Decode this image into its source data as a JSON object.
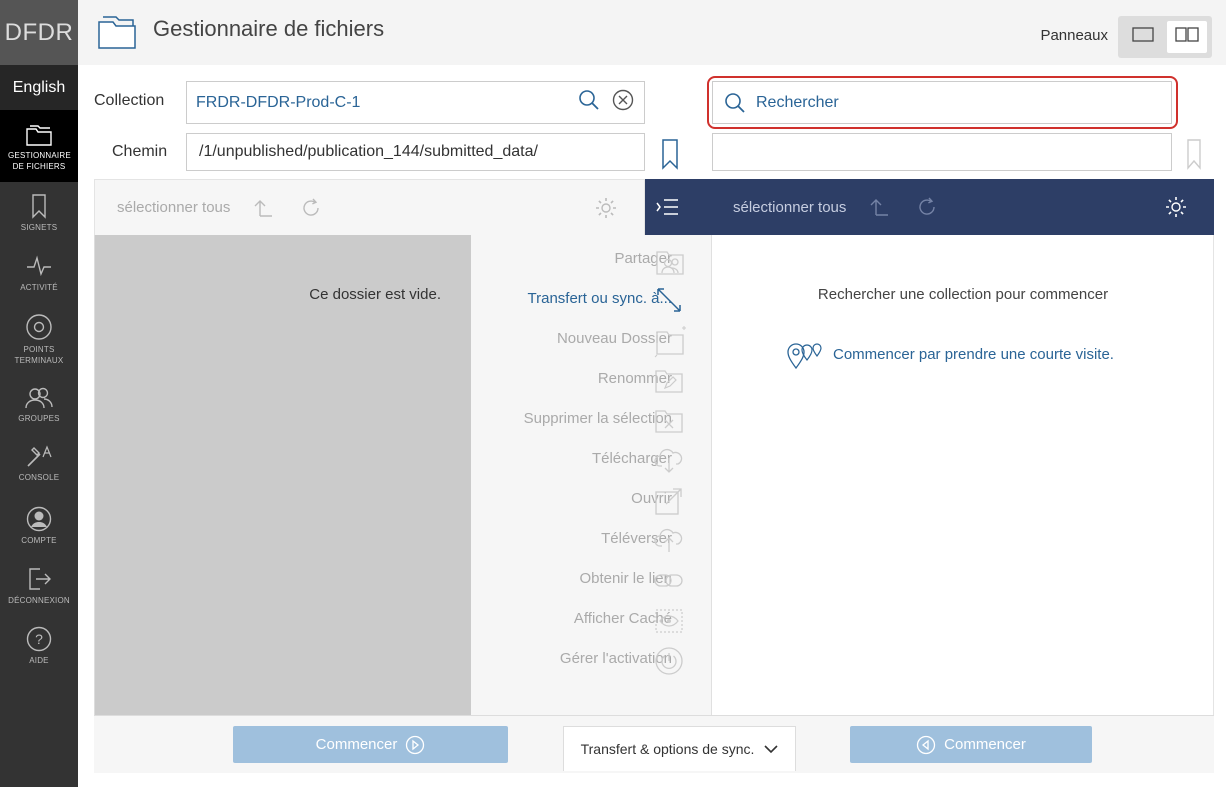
{
  "sidebar": {
    "brand": "DFDR",
    "language": "English",
    "items": [
      {
        "label": "GESTIONNAIRE DE FICHIERS",
        "icon": "folder-icon"
      },
      {
        "label": "SIGNETS",
        "icon": "bookmark-icon"
      },
      {
        "label": "ACTIVITÉ",
        "icon": "activity-icon"
      },
      {
        "label": "POINTS TERMINAUX",
        "icon": "endpoint-icon"
      },
      {
        "label": "GROUPES",
        "icon": "groups-icon"
      },
      {
        "label": "CONSOLE",
        "icon": "console-icon"
      },
      {
        "label": "COMPTE",
        "icon": "account-icon"
      },
      {
        "label": "DÉCONNEXION",
        "icon": "logout-icon"
      },
      {
        "label": "AIDE",
        "icon": "help-icon"
      }
    ]
  },
  "header": {
    "title": "Gestionnaire de fichiers",
    "panels_label": "Panneaux"
  },
  "left": {
    "collection_label": "Collection",
    "collection_value": "FRDR-DFDR-Prod-C-1",
    "path_label": "Chemin",
    "path_value": "/1/unpublished/publication_144/submitted_data/",
    "select_all": "sélectionner tous",
    "empty_text": "Ce dossier est vide."
  },
  "right": {
    "search_placeholder": "Rechercher",
    "path_value": "",
    "select_all": "sélectionner tous",
    "prompt": "Rechercher une collection pour commencer",
    "tour_link": "Commencer par prendre une courte visite."
  },
  "menu": [
    {
      "label": "Partager",
      "active": false
    },
    {
      "label": "Transfert ou sync. à...",
      "active": true
    },
    {
      "label": "Nouveau Dossier",
      "active": false
    },
    {
      "label": "Renommer",
      "active": false
    },
    {
      "label": "Supprimer la sélection",
      "active": false
    },
    {
      "label": "Télécharger",
      "active": false
    },
    {
      "label": "Ouvrir",
      "active": false
    },
    {
      "label": "Téléverser",
      "active": false
    },
    {
      "label": "Obtenir le lien",
      "active": false
    },
    {
      "label": "Afficher Caché",
      "active": false
    },
    {
      "label": "Gérer l'activation",
      "active": false
    }
  ],
  "footer": {
    "start_left": "Commencer",
    "transfer_options": "Transfert & options de sync.",
    "start_right": "Commencer"
  },
  "colors": {
    "accent": "#2a6496",
    "navy": "#2d3e66",
    "highlight_red": "#d0312d",
    "start_button": "#9fc0dd"
  }
}
